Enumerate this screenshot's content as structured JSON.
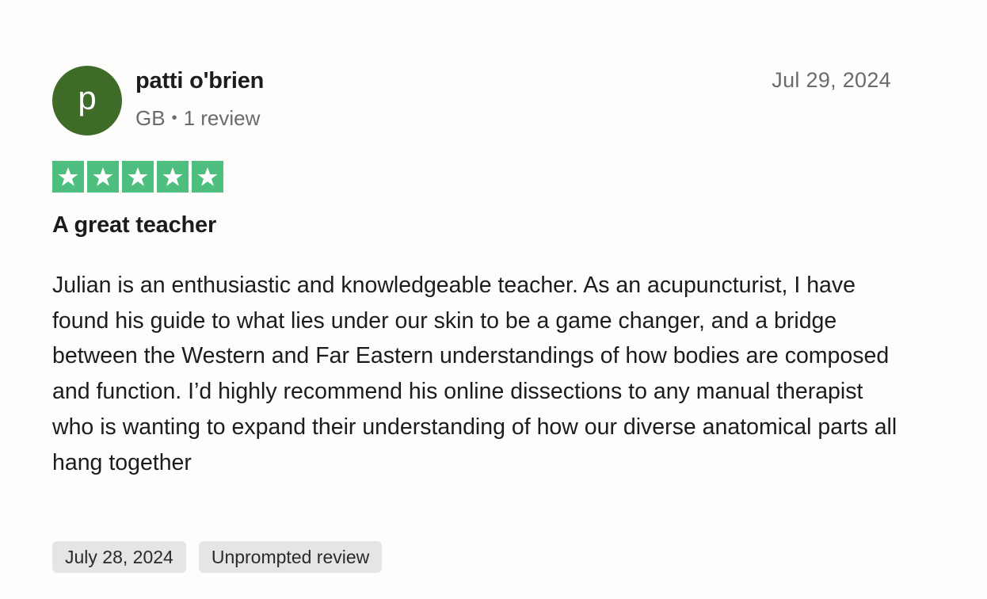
{
  "reviewer": {
    "avatar_letter": "p",
    "avatar_color": "#3f6b29",
    "name": "patti o'brien",
    "country": "GB",
    "separator": "•",
    "review_count": "1 review"
  },
  "review": {
    "date": "Jul 29, 2024",
    "rating": 5,
    "rating_max": 5,
    "star_color": "#4fbf7f",
    "star_icon": "star-icon",
    "title": "A great teacher",
    "body": "Julian is an enthusiastic and knowledgeable teacher. As an acupuncturist, I have found his guide to what lies under our skin to be a game changer, and a bridge between the Western and Far Eastern understandings of how bodies are composed and function. I’d highly recommend his online dissections to any manual therapist who is wanting to expand their understanding of how our diverse anatomical parts all hang together",
    "tags": {
      "experience_date": "July 28, 2024",
      "review_type": "Unprompted review"
    }
  }
}
